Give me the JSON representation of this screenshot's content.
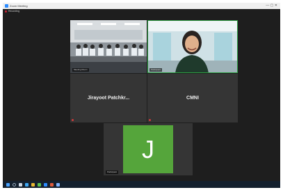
{
  "window": {
    "title": "Zoom Meeting",
    "subtitle": "Recording"
  },
  "tiles": [
    {
      "type": "video",
      "label": "Meeting Room",
      "scene": "classroom-group"
    },
    {
      "type": "video",
      "label": "Participant",
      "scene": "person-smiling",
      "active_speaker": true
    },
    {
      "type": "name",
      "name": "Jirayoot  Patchkr..."
    },
    {
      "type": "name",
      "name": "CMNI"
    },
    {
      "type": "avatar",
      "initial": "J",
      "label": "Participant",
      "avatar_color": "#55a53b"
    }
  ],
  "taskbar": {
    "icons": [
      "start-icon",
      "search-icon",
      "task-view-icon",
      "edge-icon",
      "file-explorer-icon",
      "store-icon",
      "zoom-icon",
      "settings-icon",
      "app-icon"
    ]
  }
}
